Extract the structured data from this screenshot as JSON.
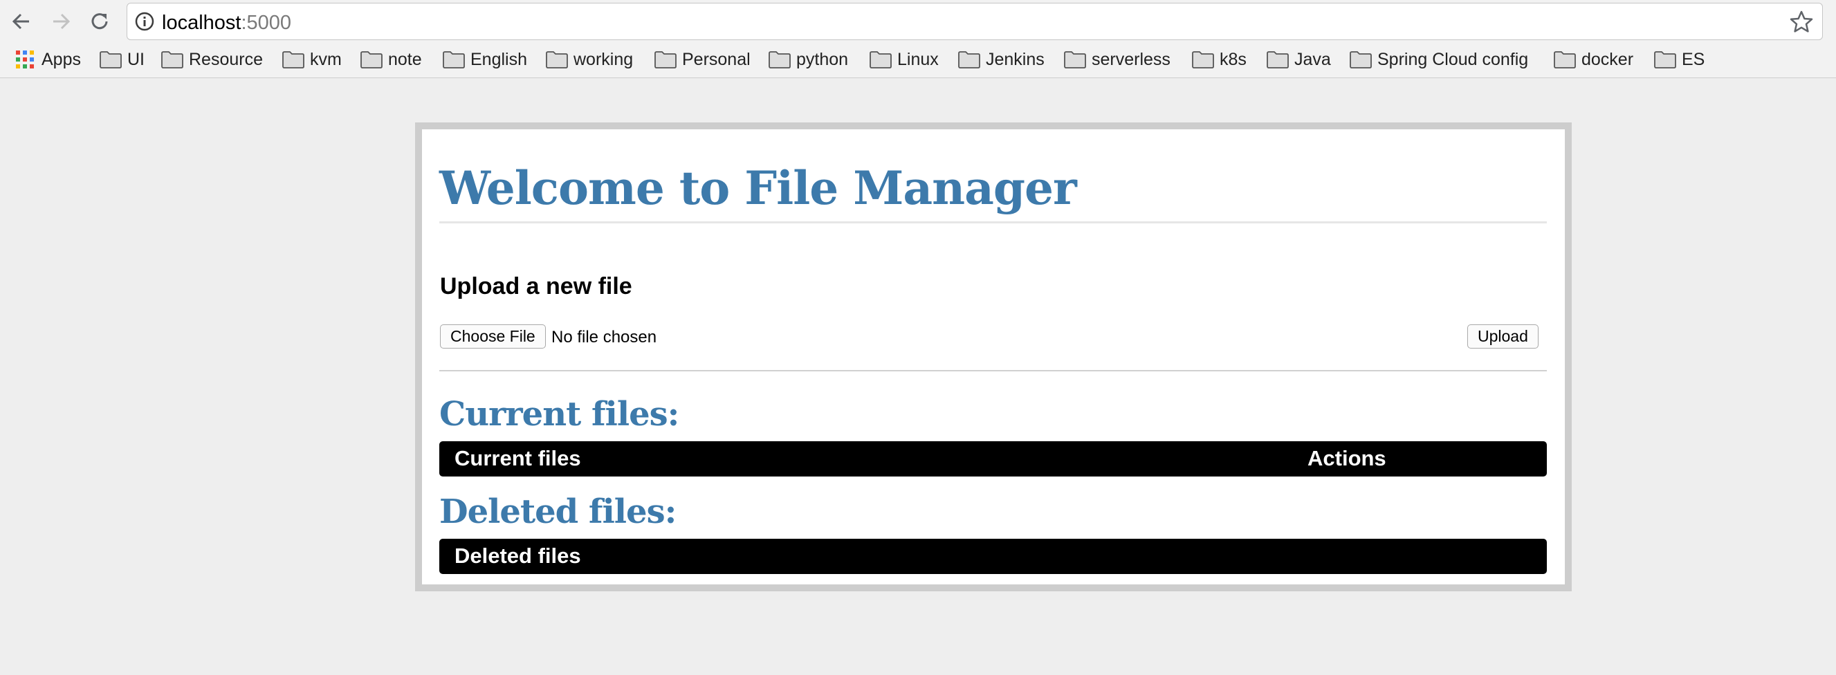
{
  "browser": {
    "url_host": "localhost",
    "url_port": ":5000",
    "bookmarks": [
      "Apps",
      "UI",
      "Resource",
      "kvm",
      "note",
      "English",
      "working",
      "Personal",
      "python",
      "Linux",
      "Jenkins",
      "serverless",
      "k8s",
      "Java",
      "Spring Cloud config",
      "docker",
      "ES"
    ],
    "icons": {
      "back": "back-arrow-icon",
      "forward": "forward-arrow-icon",
      "reload": "reload-icon",
      "info": "info-icon",
      "star": "star-icon",
      "apps": "apps-grid-icon",
      "folder": "folder-icon"
    }
  },
  "page": {
    "title": "Welcome to File Manager",
    "upload": {
      "heading": "Upload a new file",
      "choose_label": "Choose File",
      "file_status": "No file chosen",
      "upload_label": "Upload"
    },
    "current": {
      "heading": "Current files:",
      "columns": [
        "Current files",
        "Actions"
      ]
    },
    "deleted": {
      "heading": "Deleted files:",
      "columns": [
        "Deleted files"
      ]
    }
  },
  "colors": {
    "heading_blue": "#3d7aab",
    "table_header_bg": "#000000",
    "page_bg": "#eeeeee",
    "container_border": "#cdcdcd"
  }
}
